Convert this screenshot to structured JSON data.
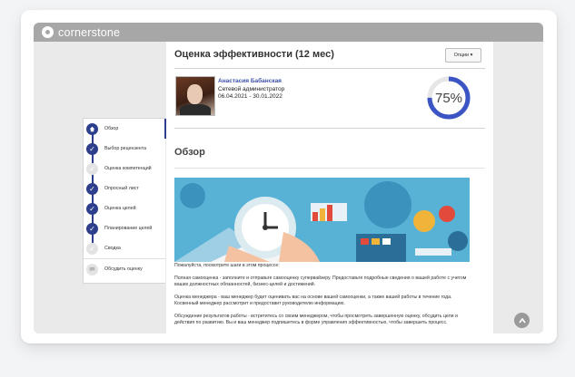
{
  "app": {
    "brand": "cornerstone"
  },
  "steps": [
    {
      "label": "Обзор",
      "state": "active"
    },
    {
      "label": "Выбор рецензента",
      "state": "done"
    },
    {
      "label": "Оценка компетенций",
      "state": "pending"
    },
    {
      "label": "Опросный лист",
      "state": "done"
    },
    {
      "label": "Оценка целей",
      "state": "done"
    },
    {
      "label": "Планирование целей",
      "state": "done"
    },
    {
      "label": "Сводка",
      "state": "pending"
    },
    {
      "label": "Обсудить оценку",
      "state": "comment"
    }
  ],
  "page": {
    "title": "Оценка эффективности (12 мес)",
    "options_label": "Опции ▾"
  },
  "employee": {
    "name": "Анастасия Бабанская",
    "role": "Сетевой администратор",
    "dates": "06.04.2021 - 30.01.2022"
  },
  "progress": {
    "percent_label": "75%",
    "value": 0.75,
    "color": "#3b56c4"
  },
  "overview": {
    "title": "Обзор",
    "intro": "Пожалуйста, посмотрите шаги в этом процессе:",
    "p1": "Полная самооценка - заполните и отправьте самооценку супервайзеру. Предоставьте подробные сведения о вашей работе с учетом ваших должностных обязанностей, бизнес-целей и достижений.",
    "p2": "Оценка менеджера - ваш менеджер будет оценивать вас на основе вашей самооценки, а также вашей работы в течение года. Косвенный менеджер рассмотрит и предоставит руководителю информацию.",
    "p3": "Обсуждение результатов работы - встретитесь со своим менеджером, чтобы просмотреть завершенную оценку, обсудить цели и действия по развитию. Вы и ваш менеджер подпишетесь в форме управления эффективностью, чтобы завершить процесс."
  },
  "colors": {
    "accent": "#2c3e8c",
    "topbar": "#a7a7a7",
    "banner": "#57b2d6"
  }
}
